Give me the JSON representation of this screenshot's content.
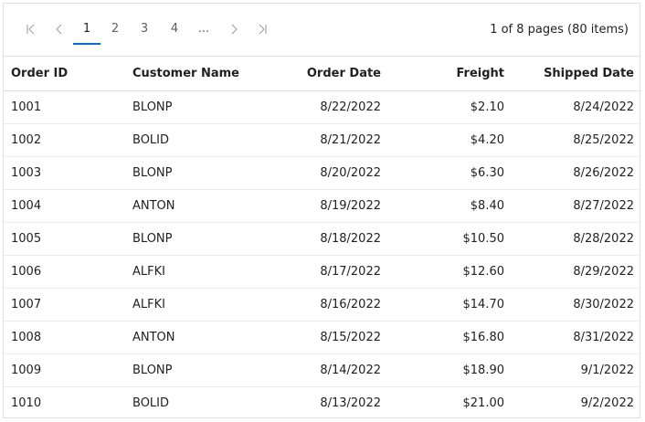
{
  "pager": {
    "first_icon": "first-page-icon",
    "prev_icon": "previous-page-icon",
    "pages": [
      "1",
      "2",
      "3",
      "4"
    ],
    "active_page": "1",
    "ellipsis": "...",
    "next_icon": "next-page-icon",
    "last_icon": "last-page-icon",
    "info": "1 of 8 pages (80 items)",
    "accent_color": "#0f6cbd"
  },
  "grid": {
    "columns": [
      "Order ID",
      "Customer Name",
      "Order Date",
      "Freight",
      "Shipped Date"
    ],
    "rows": [
      [
        "1001",
        "BLONP",
        "8/22/2022",
        "$2.10",
        "8/24/2022"
      ],
      [
        "1002",
        "BOLID",
        "8/21/2022",
        "$4.20",
        "8/25/2022"
      ],
      [
        "1003",
        "BLONP",
        "8/20/2022",
        "$6.30",
        "8/26/2022"
      ],
      [
        "1004",
        "ANTON",
        "8/19/2022",
        "$8.40",
        "8/27/2022"
      ],
      [
        "1005",
        "BLONP",
        "8/18/2022",
        "$10.50",
        "8/28/2022"
      ],
      [
        "1006",
        "ALFKI",
        "8/17/2022",
        "$12.60",
        "8/29/2022"
      ],
      [
        "1007",
        "ALFKI",
        "8/16/2022",
        "$14.70",
        "8/30/2022"
      ],
      [
        "1008",
        "ANTON",
        "8/15/2022",
        "$16.80",
        "8/31/2022"
      ],
      [
        "1009",
        "BLONP",
        "8/14/2022",
        "$18.90",
        "9/1/2022"
      ],
      [
        "1010",
        "BOLID",
        "8/13/2022",
        "$21.00",
        "9/2/2022"
      ]
    ]
  }
}
